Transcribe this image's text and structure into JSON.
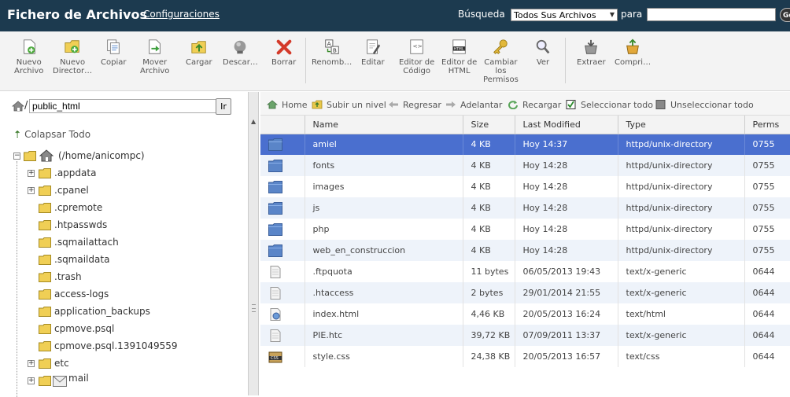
{
  "header": {
    "title": "Fichero de Archivos",
    "settings_link": "Configuraciones",
    "search_label": "Búsqueda",
    "search_scope": "Todos Sus Archivos",
    "para_label": "para",
    "search_value": "",
    "go_label": "Go"
  },
  "toolbar": [
    {
      "label": "Nuevo\nArchivo",
      "icon": "new-file-icon"
    },
    {
      "label": "Nuevo\nDirector…",
      "icon": "new-folder-icon"
    },
    {
      "label": "Copiar",
      "icon": "copy-icon"
    },
    {
      "label": "Mover\nArchivo",
      "icon": "move-file-icon"
    },
    {
      "label": "Cargar",
      "icon": "upload-icon"
    },
    {
      "label": "Descar…",
      "icon": "download-icon"
    },
    {
      "label": "Borrar",
      "icon": "delete-icon"
    },
    {
      "label": "Renomb…",
      "icon": "rename-icon"
    },
    {
      "label": "Editar",
      "icon": "edit-icon"
    },
    {
      "label": "Editor de\nCódigo",
      "icon": "code-editor-icon"
    },
    {
      "label": "Editor de\nHTML",
      "icon": "html-editor-icon"
    },
    {
      "label": "Cambiar\nlos\nPermisos",
      "icon": "permissions-key-icon"
    },
    {
      "label": "Ver",
      "icon": "view-magnifier-icon"
    },
    {
      "label": "Extraer",
      "icon": "extract-icon"
    },
    {
      "label": "Compri…",
      "icon": "compress-icon"
    }
  ],
  "path_bar": {
    "slash": "/",
    "path": "public_html",
    "go_label": "Ir"
  },
  "tree": {
    "collapse_label": "Colapsar Todo",
    "root_label": "(/home/anicompc)",
    "items": [
      {
        "label": ".appdata",
        "expandable": true
      },
      {
        "label": ".cpanel",
        "expandable": true
      },
      {
        "label": ".cpremote",
        "expandable": false
      },
      {
        "label": ".htpasswds",
        "expandable": false
      },
      {
        "label": ".sqmailattach",
        "expandable": false
      },
      {
        "label": ".sqmaildata",
        "expandable": false
      },
      {
        "label": ".trash",
        "expandable": false
      },
      {
        "label": "access-logs",
        "expandable": false
      },
      {
        "label": "application_backups",
        "expandable": false
      },
      {
        "label": "cpmove.psql",
        "expandable": false
      },
      {
        "label": "cpmove.psql.1391049559",
        "expandable": false
      },
      {
        "label": "etc",
        "expandable": true
      },
      {
        "label": "mail",
        "expandable": true
      }
    ]
  },
  "nav": {
    "home": "Home",
    "up": "Subir un nivel",
    "back": "Regresar",
    "forward": "Adelantar",
    "reload": "Recargar",
    "select_all": "Seleccionar todo",
    "unselect_all": "Unseleccionar todo"
  },
  "table": {
    "columns": [
      "Name",
      "Size",
      "Last Modified",
      "Type",
      "Perms"
    ],
    "rows": [
      {
        "name": "amiel",
        "size": "4 KB",
        "modified": "Hoy 14:37",
        "type": "httpd/unix-directory",
        "perms": "0755",
        "kind": "folder"
      },
      {
        "name": "fonts",
        "size": "4 KB",
        "modified": "Hoy 14:28",
        "type": "httpd/unix-directory",
        "perms": "0755",
        "kind": "folder"
      },
      {
        "name": "images",
        "size": "4 KB",
        "modified": "Hoy 14:28",
        "type": "httpd/unix-directory",
        "perms": "0755",
        "kind": "folder"
      },
      {
        "name": "js",
        "size": "4 KB",
        "modified": "Hoy 14:28",
        "type": "httpd/unix-directory",
        "perms": "0755",
        "kind": "folder"
      },
      {
        "name": "php",
        "size": "4 KB",
        "modified": "Hoy 14:28",
        "type": "httpd/unix-directory",
        "perms": "0755",
        "kind": "folder"
      },
      {
        "name": "web_en_construccion",
        "size": "4 KB",
        "modified": "Hoy 14:28",
        "type": "httpd/unix-directory",
        "perms": "0755",
        "kind": "folder"
      },
      {
        "name": ".ftpquota",
        "size": "11 bytes",
        "modified": "06/05/2013 19:43",
        "type": "text/x-generic",
        "perms": "0644",
        "kind": "generic"
      },
      {
        "name": ".htaccess",
        "size": "2 bytes",
        "modified": "29/01/2014 21:55",
        "type": "text/x-generic",
        "perms": "0644",
        "kind": "generic"
      },
      {
        "name": "index.html",
        "size": "4,46 KB",
        "modified": "20/05/2013 16:24",
        "type": "text/html",
        "perms": "0644",
        "kind": "html"
      },
      {
        "name": "PIE.htc",
        "size": "39,72 KB",
        "modified": "07/09/2011 13:37",
        "type": "text/x-generic",
        "perms": "0644",
        "kind": "generic"
      },
      {
        "name": "style.css",
        "size": "24,38 KB",
        "modified": "20/05/2013 16:57",
        "type": "text/css",
        "perms": "0644",
        "kind": "css"
      }
    ],
    "selected_index": 0
  },
  "colors": {
    "header_bg": "#1c3a4f",
    "selected_row": "#4a6fcf",
    "alt_row": "#eef3fa"
  }
}
